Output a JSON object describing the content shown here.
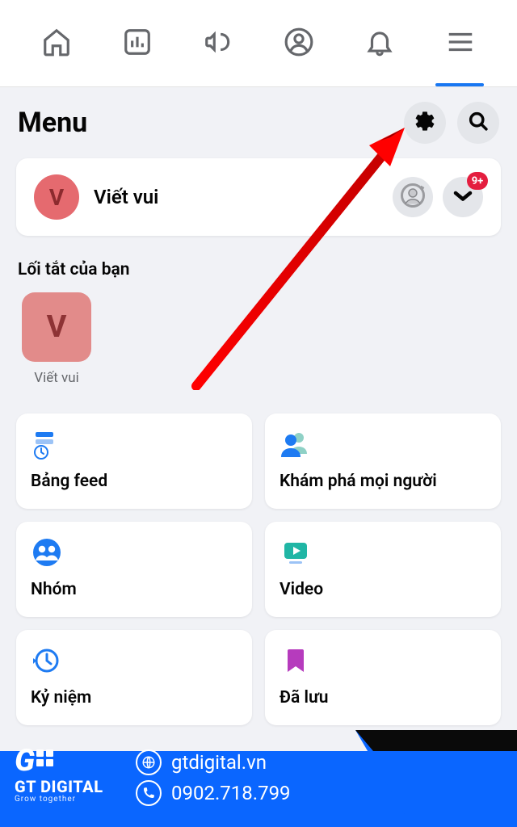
{
  "header": {
    "title": "Menu"
  },
  "profile": {
    "initial": "V",
    "name": "Viết vui",
    "switch_badge": "9+"
  },
  "shortcuts": {
    "label": "Lối tắt của bạn",
    "items": [
      {
        "initial": "V",
        "label": "Viết vui"
      }
    ]
  },
  "grid": [
    {
      "label": "Bảng feed"
    },
    {
      "label": "Khám phá mọi người"
    },
    {
      "label": "Nhóm"
    },
    {
      "label": "Video"
    },
    {
      "label": "Kỷ niệm"
    },
    {
      "label": "Đã lưu"
    }
  ],
  "footer": {
    "brand_top": "GT DIGITAL",
    "brand_sub": "Grow together",
    "website": "gtdigital.vn",
    "phone": "0902.718.799"
  }
}
